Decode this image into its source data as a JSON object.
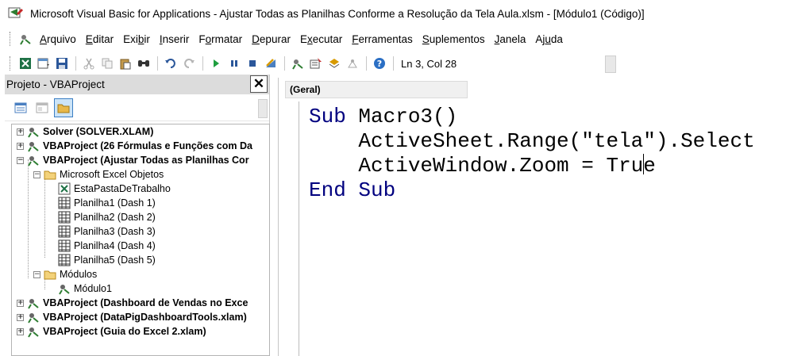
{
  "window": {
    "title": "Microsoft Visual Basic for Applications - Ajustar Todas as Planilhas Conforme a Resolução da Tela Aula.xlsm - [Módulo1 (Código)]"
  },
  "menu": {
    "items": [
      {
        "pre": "",
        "u": "A",
        "post": "rquivo"
      },
      {
        "pre": "",
        "u": "E",
        "post": "ditar"
      },
      {
        "pre": "Exi",
        "u": "b",
        "post": "ir"
      },
      {
        "pre": "",
        "u": "I",
        "post": "nserir"
      },
      {
        "pre": "F",
        "u": "o",
        "post": "rmatar"
      },
      {
        "pre": "",
        "u": "D",
        "post": "epurar"
      },
      {
        "pre": "E",
        "u": "x",
        "post": "ecutar"
      },
      {
        "pre": "",
        "u": "F",
        "post": "erramentas"
      },
      {
        "pre": "",
        "u": "S",
        "post": "uplementos"
      },
      {
        "pre": "",
        "u": "J",
        "post": "anela"
      },
      {
        "pre": "Aj",
        "u": "u",
        "post": "da"
      }
    ]
  },
  "toolbar": {
    "status": "Ln 3, Col 28"
  },
  "project": {
    "title": "Projeto - VBAProject",
    "tree": [
      {
        "label": "Solver (SOLVER.XLAM)"
      },
      {
        "label": "VBAProject (26 Fórmulas e Funções com Da"
      },
      {
        "label": "VBAProject (Ajustar Todas as Planilhas Cor"
      },
      {
        "label": "Microsoft Excel Objetos"
      },
      {
        "label": "EstaPastaDeTrabalho"
      },
      {
        "label": "Planilha1 (Dash 1)"
      },
      {
        "label": "Planilha2 (Dash 2)"
      },
      {
        "label": "Planilha3 (Dash 3)"
      },
      {
        "label": "Planilha4 (Dash 4)"
      },
      {
        "label": "Planilha5 (Dash 5)"
      },
      {
        "label": "Módulos"
      },
      {
        "label": "Módulo1"
      },
      {
        "label": "VBAProject (Dashboard de Vendas no Exce"
      },
      {
        "label": "VBAProject (DataPigDashboardTools.xlam)"
      },
      {
        "label": "VBAProject (Guia do Excel 2.xlam)"
      }
    ]
  },
  "code": {
    "object_combo": "(Geral)",
    "line1_kw": "Sub",
    "line1_rest": " Macro3()",
    "line2": "    ActiveSheet.Range(\"tela\").Select",
    "line3_pre": "    ActiveWindow.Zoom = Tru",
    "line3_post": "e",
    "line4_kw1": "End",
    "line4_kw2": "Sub"
  },
  "colors": {
    "keyword": "#00007f",
    "selection": "#cce4f7"
  }
}
